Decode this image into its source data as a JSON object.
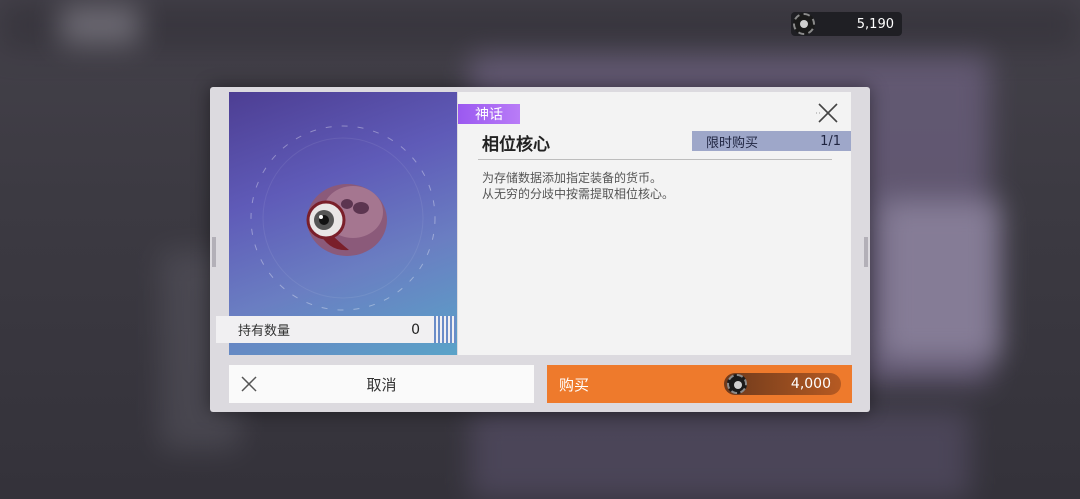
{
  "currency": {
    "icon": "gear-coin-icon",
    "amount": "5,190"
  },
  "item": {
    "rarity": "神话",
    "name": "相位核心",
    "limit_label": "限时购买",
    "limit_count": "1/1",
    "description_line1": "为存储数据添加指定装备的货币。",
    "description_line2": "从无穷的分歧中按需提取相位核心。",
    "hold_label": "持有数量",
    "hold_value": "0",
    "icon": "eyeball-skull-icon"
  },
  "buttons": {
    "cancel_label": "取消",
    "buy_label": "购买",
    "price": "4,000"
  },
  "colors": {
    "accent_buy": "#ee7a2c",
    "rarity": "#9b59f0",
    "limit_bar": "#9ea7c9"
  }
}
